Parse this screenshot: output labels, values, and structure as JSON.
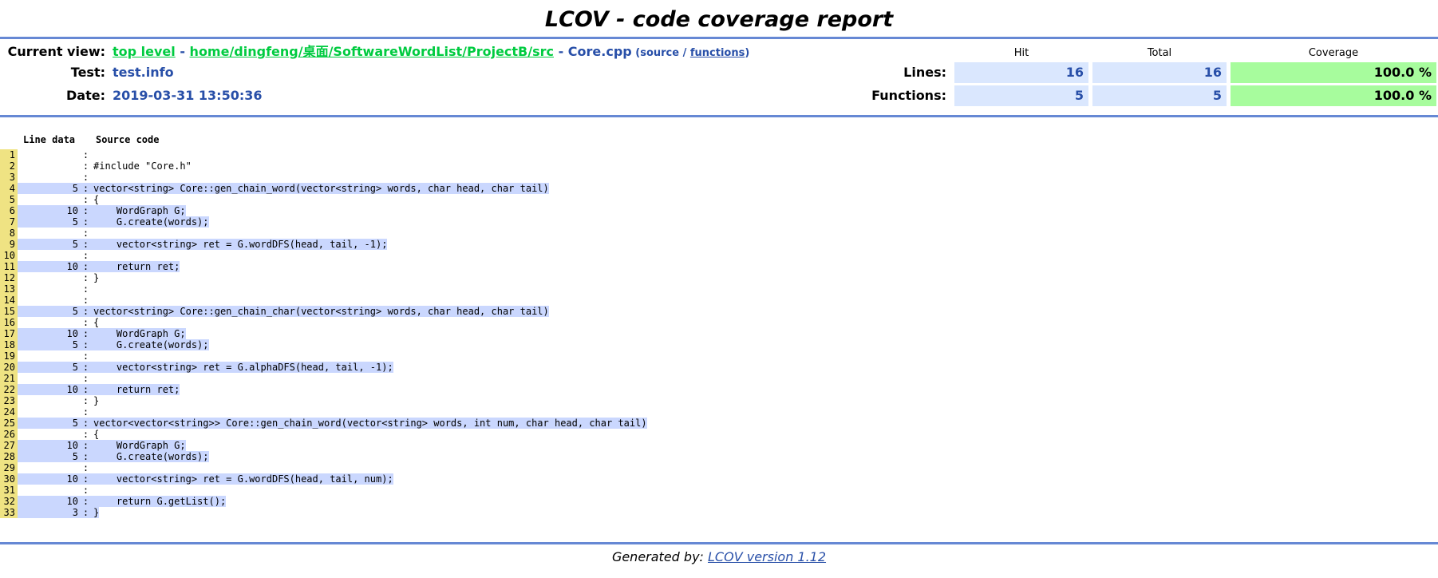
{
  "title": "LCOV - code coverage report",
  "header": {
    "current_view_label": "Current view:",
    "breadcrumb": {
      "top": "top level",
      "sep1": " - ",
      "dir": "home/dingfeng/桌面/SoftwareWordList/ProjectB/src",
      "sep2": " - ",
      "file": "Core.cpp",
      "open_paren": " (",
      "source_link": "source",
      "slash": " / ",
      "functions_link": "functions",
      "close_paren": ")"
    },
    "test_label": "Test:",
    "test_value": "test.info",
    "date_label": "Date:",
    "date_value": "2019-03-31 13:50:36"
  },
  "coverage": {
    "col_hit": "Hit",
    "col_total": "Total",
    "col_coverage": "Coverage",
    "lines_label": "Lines:",
    "lines_hit": "16",
    "lines_total": "16",
    "lines_cov": "100.0 %",
    "functions_label": "Functions:",
    "functions_hit": "5",
    "functions_total": "5",
    "functions_cov": "100.0 %"
  },
  "code_header": {
    "line_data": "Line data",
    "source_code": "Source code"
  },
  "lines": [
    {
      "n": "1",
      "c": "",
      "s": ""
    },
    {
      "n": "2",
      "c": "",
      "s": "#include \"Core.h\""
    },
    {
      "n": "3",
      "c": "",
      "s": ""
    },
    {
      "n": "4",
      "c": "5",
      "s": "vector<string> Core::gen_chain_word(vector<string> words, char head, char tail)"
    },
    {
      "n": "5",
      "c": "",
      "s": "{"
    },
    {
      "n": "6",
      "c": "10",
      "s": "    WordGraph G;"
    },
    {
      "n": "7",
      "c": "5",
      "s": "    G.create(words);"
    },
    {
      "n": "8",
      "c": "",
      "s": ""
    },
    {
      "n": "9",
      "c": "5",
      "s": "    vector<string> ret = G.wordDFS(head, tail, -1);"
    },
    {
      "n": "10",
      "c": "",
      "s": ""
    },
    {
      "n": "11",
      "c": "10",
      "s": "    return ret;"
    },
    {
      "n": "12",
      "c": "",
      "s": "}"
    },
    {
      "n": "13",
      "c": "",
      "s": ""
    },
    {
      "n": "14",
      "c": "",
      "s": ""
    },
    {
      "n": "15",
      "c": "5",
      "s": "vector<string> Core::gen_chain_char(vector<string> words, char head, char tail)"
    },
    {
      "n": "16",
      "c": "",
      "s": "{"
    },
    {
      "n": "17",
      "c": "10",
      "s": "    WordGraph G;"
    },
    {
      "n": "18",
      "c": "5",
      "s": "    G.create(words);"
    },
    {
      "n": "19",
      "c": "",
      "s": ""
    },
    {
      "n": "20",
      "c": "5",
      "s": "    vector<string> ret = G.alphaDFS(head, tail, -1);"
    },
    {
      "n": "21",
      "c": "",
      "s": ""
    },
    {
      "n": "22",
      "c": "10",
      "s": "    return ret;"
    },
    {
      "n": "23",
      "c": "",
      "s": "}"
    },
    {
      "n": "24",
      "c": "",
      "s": ""
    },
    {
      "n": "25",
      "c": "5",
      "s": "vector<vector<string>> Core::gen_chain_word(vector<string> words, int num, char head, char tail)"
    },
    {
      "n": "26",
      "c": "",
      "s": "{"
    },
    {
      "n": "27",
      "c": "10",
      "s": "    WordGraph G;"
    },
    {
      "n": "28",
      "c": "5",
      "s": "    G.create(words);"
    },
    {
      "n": "29",
      "c": "",
      "s": ""
    },
    {
      "n": "30",
      "c": "10",
      "s": "    vector<string> ret = G.wordDFS(head, tail, num);"
    },
    {
      "n": "31",
      "c": "",
      "s": ""
    },
    {
      "n": "32",
      "c": "10",
      "s": "    return G.getList();"
    },
    {
      "n": "33",
      "c": "3",
      "s": "}"
    }
  ],
  "footer": {
    "prefix": "Generated by: ",
    "link": "LCOV version 1.12"
  },
  "colors": {
    "rule": "#6688d4",
    "link_green": "#00cb40",
    "text_blue": "#284fa8",
    "cell_blue": "#dae7fe",
    "cell_green": "#a7fc9d",
    "line_number_bg": "#efe383",
    "hit_bg": "#cad7fe"
  }
}
